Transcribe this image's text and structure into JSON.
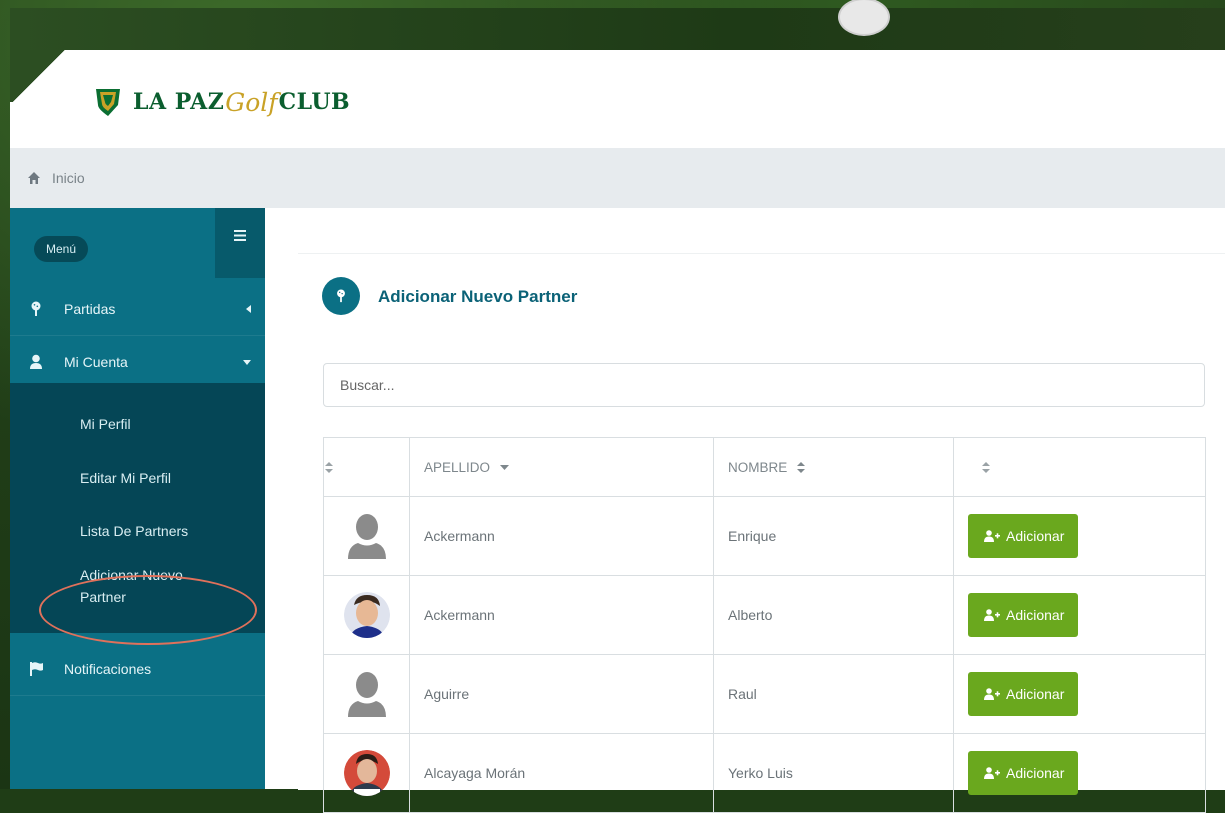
{
  "brand": {
    "name_part1": "LA PAZ",
    "name_part2": "Golf",
    "name_part3": "CLUB"
  },
  "breadcrumb": {
    "home": "Inicio"
  },
  "sidebar": {
    "menu_label": "Menú",
    "items": [
      {
        "label": "Partidas",
        "icon": "golf-icon",
        "caret": "left"
      },
      {
        "label": "Mi Cuenta",
        "icon": "user-icon",
        "caret": "down"
      },
      {
        "label": "Notificaciones",
        "icon": "flag-icon"
      }
    ],
    "sub_items": [
      {
        "label": "Mi Perfil"
      },
      {
        "label": "Editar Mi Perfil"
      },
      {
        "label": "Lista De Partners"
      },
      {
        "label": "Adicionar Nuevo Partner",
        "line1": "Adicionar Nuevo",
        "line2": "Partner"
      }
    ]
  },
  "main": {
    "title": "Adicionar Nuevo Partner",
    "search_placeholder": "Buscar...",
    "columns": [
      "",
      "APELLIDO",
      "NOMBRE",
      ""
    ],
    "rows": [
      {
        "apellido": "Ackermann",
        "nombre": "Enrique",
        "avatar": "placeholder",
        "action": "Adicionar"
      },
      {
        "apellido": "Ackermann",
        "nombre": "Alberto",
        "avatar": "photo",
        "action": "Adicionar"
      },
      {
        "apellido": "Aguirre",
        "nombre": "Raul",
        "avatar": "placeholder",
        "action": "Adicionar"
      },
      {
        "apellido": "Alcayaga Morán",
        "nombre": "Yerko Luis",
        "avatar": "photo",
        "action": "Adicionar"
      }
    ]
  },
  "colors": {
    "sidebar": "#0b7085",
    "sidebar_sub": "#054656",
    "button": "#6aa81e",
    "title": "#0b6277",
    "annotation": "#e0715b"
  }
}
